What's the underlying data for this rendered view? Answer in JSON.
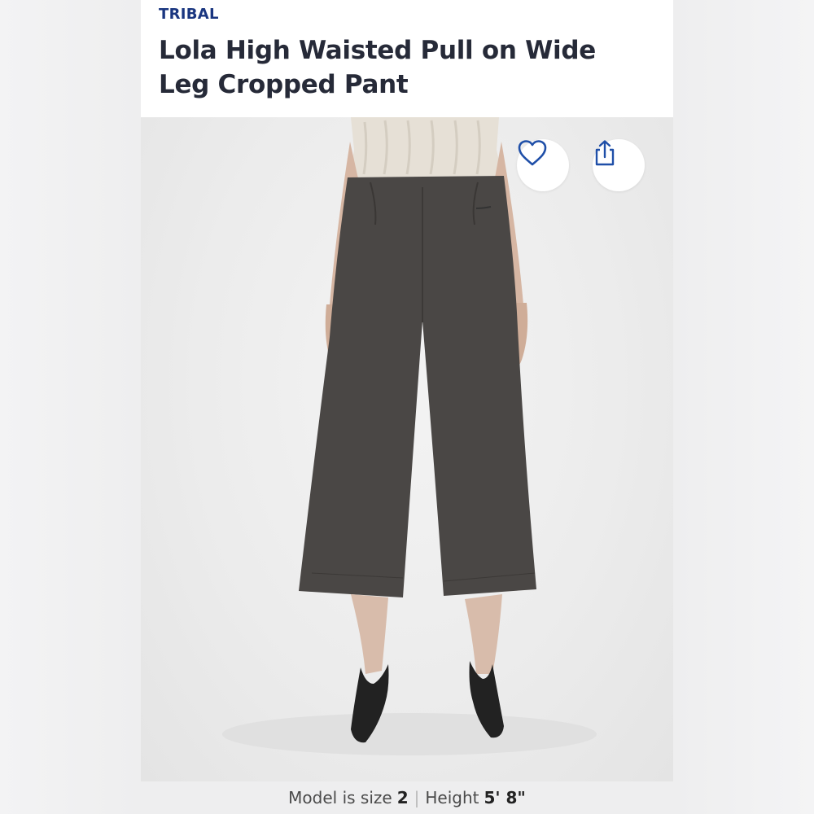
{
  "product": {
    "brand": "TRIBAL",
    "title": "Lola High Waisted Pull on Wide Leg Cropped Pant"
  },
  "actions": {
    "favorite_icon": "heart-icon",
    "share_icon": "share-icon"
  },
  "caption": {
    "size_label": "Model is size",
    "size_value": "2",
    "height_label": "Height",
    "height_value": "5' 8\""
  },
  "colors": {
    "brand": "#1a3680",
    "icon": "#1f4fa8",
    "title": "#262a38"
  }
}
